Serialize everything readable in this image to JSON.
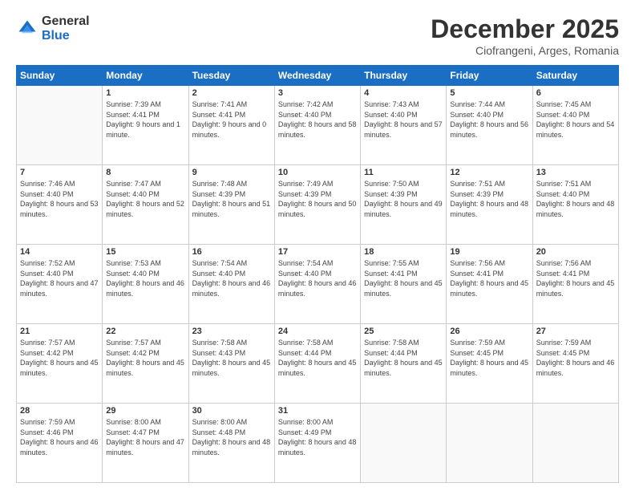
{
  "logo": {
    "general": "General",
    "blue": "Blue"
  },
  "title": "December 2025",
  "location": "Ciofrangeni, Arges, Romania",
  "days_of_week": [
    "Sunday",
    "Monday",
    "Tuesday",
    "Wednesday",
    "Thursday",
    "Friday",
    "Saturday"
  ],
  "weeks": [
    [
      {
        "day": "",
        "sunrise": "",
        "sunset": "",
        "daylight": ""
      },
      {
        "day": "1",
        "sunrise": "Sunrise: 7:39 AM",
        "sunset": "Sunset: 4:41 PM",
        "daylight": "Daylight: 9 hours and 1 minute."
      },
      {
        "day": "2",
        "sunrise": "Sunrise: 7:41 AM",
        "sunset": "Sunset: 4:41 PM",
        "daylight": "Daylight: 9 hours and 0 minutes."
      },
      {
        "day": "3",
        "sunrise": "Sunrise: 7:42 AM",
        "sunset": "Sunset: 4:40 PM",
        "daylight": "Daylight: 8 hours and 58 minutes."
      },
      {
        "day": "4",
        "sunrise": "Sunrise: 7:43 AM",
        "sunset": "Sunset: 4:40 PM",
        "daylight": "Daylight: 8 hours and 57 minutes."
      },
      {
        "day": "5",
        "sunrise": "Sunrise: 7:44 AM",
        "sunset": "Sunset: 4:40 PM",
        "daylight": "Daylight: 8 hours and 56 minutes."
      },
      {
        "day": "6",
        "sunrise": "Sunrise: 7:45 AM",
        "sunset": "Sunset: 4:40 PM",
        "daylight": "Daylight: 8 hours and 54 minutes."
      }
    ],
    [
      {
        "day": "7",
        "sunrise": "Sunrise: 7:46 AM",
        "sunset": "Sunset: 4:40 PM",
        "daylight": "Daylight: 8 hours and 53 minutes."
      },
      {
        "day": "8",
        "sunrise": "Sunrise: 7:47 AM",
        "sunset": "Sunset: 4:40 PM",
        "daylight": "Daylight: 8 hours and 52 minutes."
      },
      {
        "day": "9",
        "sunrise": "Sunrise: 7:48 AM",
        "sunset": "Sunset: 4:39 PM",
        "daylight": "Daylight: 8 hours and 51 minutes."
      },
      {
        "day": "10",
        "sunrise": "Sunrise: 7:49 AM",
        "sunset": "Sunset: 4:39 PM",
        "daylight": "Daylight: 8 hours and 50 minutes."
      },
      {
        "day": "11",
        "sunrise": "Sunrise: 7:50 AM",
        "sunset": "Sunset: 4:39 PM",
        "daylight": "Daylight: 8 hours and 49 minutes."
      },
      {
        "day": "12",
        "sunrise": "Sunrise: 7:51 AM",
        "sunset": "Sunset: 4:39 PM",
        "daylight": "Daylight: 8 hours and 48 minutes."
      },
      {
        "day": "13",
        "sunrise": "Sunrise: 7:51 AM",
        "sunset": "Sunset: 4:40 PM",
        "daylight": "Daylight: 8 hours and 48 minutes."
      }
    ],
    [
      {
        "day": "14",
        "sunrise": "Sunrise: 7:52 AM",
        "sunset": "Sunset: 4:40 PM",
        "daylight": "Daylight: 8 hours and 47 minutes."
      },
      {
        "day": "15",
        "sunrise": "Sunrise: 7:53 AM",
        "sunset": "Sunset: 4:40 PM",
        "daylight": "Daylight: 8 hours and 46 minutes."
      },
      {
        "day": "16",
        "sunrise": "Sunrise: 7:54 AM",
        "sunset": "Sunset: 4:40 PM",
        "daylight": "Daylight: 8 hours and 46 minutes."
      },
      {
        "day": "17",
        "sunrise": "Sunrise: 7:54 AM",
        "sunset": "Sunset: 4:40 PM",
        "daylight": "Daylight: 8 hours and 46 minutes."
      },
      {
        "day": "18",
        "sunrise": "Sunrise: 7:55 AM",
        "sunset": "Sunset: 4:41 PM",
        "daylight": "Daylight: 8 hours and 45 minutes."
      },
      {
        "day": "19",
        "sunrise": "Sunrise: 7:56 AM",
        "sunset": "Sunset: 4:41 PM",
        "daylight": "Daylight: 8 hours and 45 minutes."
      },
      {
        "day": "20",
        "sunrise": "Sunrise: 7:56 AM",
        "sunset": "Sunset: 4:41 PM",
        "daylight": "Daylight: 8 hours and 45 minutes."
      }
    ],
    [
      {
        "day": "21",
        "sunrise": "Sunrise: 7:57 AM",
        "sunset": "Sunset: 4:42 PM",
        "daylight": "Daylight: 8 hours and 45 minutes."
      },
      {
        "day": "22",
        "sunrise": "Sunrise: 7:57 AM",
        "sunset": "Sunset: 4:42 PM",
        "daylight": "Daylight: 8 hours and 45 minutes."
      },
      {
        "day": "23",
        "sunrise": "Sunrise: 7:58 AM",
        "sunset": "Sunset: 4:43 PM",
        "daylight": "Daylight: 8 hours and 45 minutes."
      },
      {
        "day": "24",
        "sunrise": "Sunrise: 7:58 AM",
        "sunset": "Sunset: 4:44 PM",
        "daylight": "Daylight: 8 hours and 45 minutes."
      },
      {
        "day": "25",
        "sunrise": "Sunrise: 7:58 AM",
        "sunset": "Sunset: 4:44 PM",
        "daylight": "Daylight: 8 hours and 45 minutes."
      },
      {
        "day": "26",
        "sunrise": "Sunrise: 7:59 AM",
        "sunset": "Sunset: 4:45 PM",
        "daylight": "Daylight: 8 hours and 45 minutes."
      },
      {
        "day": "27",
        "sunrise": "Sunrise: 7:59 AM",
        "sunset": "Sunset: 4:45 PM",
        "daylight": "Daylight: 8 hours and 46 minutes."
      }
    ],
    [
      {
        "day": "28",
        "sunrise": "Sunrise: 7:59 AM",
        "sunset": "Sunset: 4:46 PM",
        "daylight": "Daylight: 8 hours and 46 minutes."
      },
      {
        "day": "29",
        "sunrise": "Sunrise: 8:00 AM",
        "sunset": "Sunset: 4:47 PM",
        "daylight": "Daylight: 8 hours and 47 minutes."
      },
      {
        "day": "30",
        "sunrise": "Sunrise: 8:00 AM",
        "sunset": "Sunset: 4:48 PM",
        "daylight": "Daylight: 8 hours and 48 minutes."
      },
      {
        "day": "31",
        "sunrise": "Sunrise: 8:00 AM",
        "sunset": "Sunset: 4:49 PM",
        "daylight": "Daylight: 8 hours and 48 minutes."
      },
      {
        "day": "",
        "sunrise": "",
        "sunset": "",
        "daylight": ""
      },
      {
        "day": "",
        "sunrise": "",
        "sunset": "",
        "daylight": ""
      },
      {
        "day": "",
        "sunrise": "",
        "sunset": "",
        "daylight": ""
      }
    ]
  ]
}
